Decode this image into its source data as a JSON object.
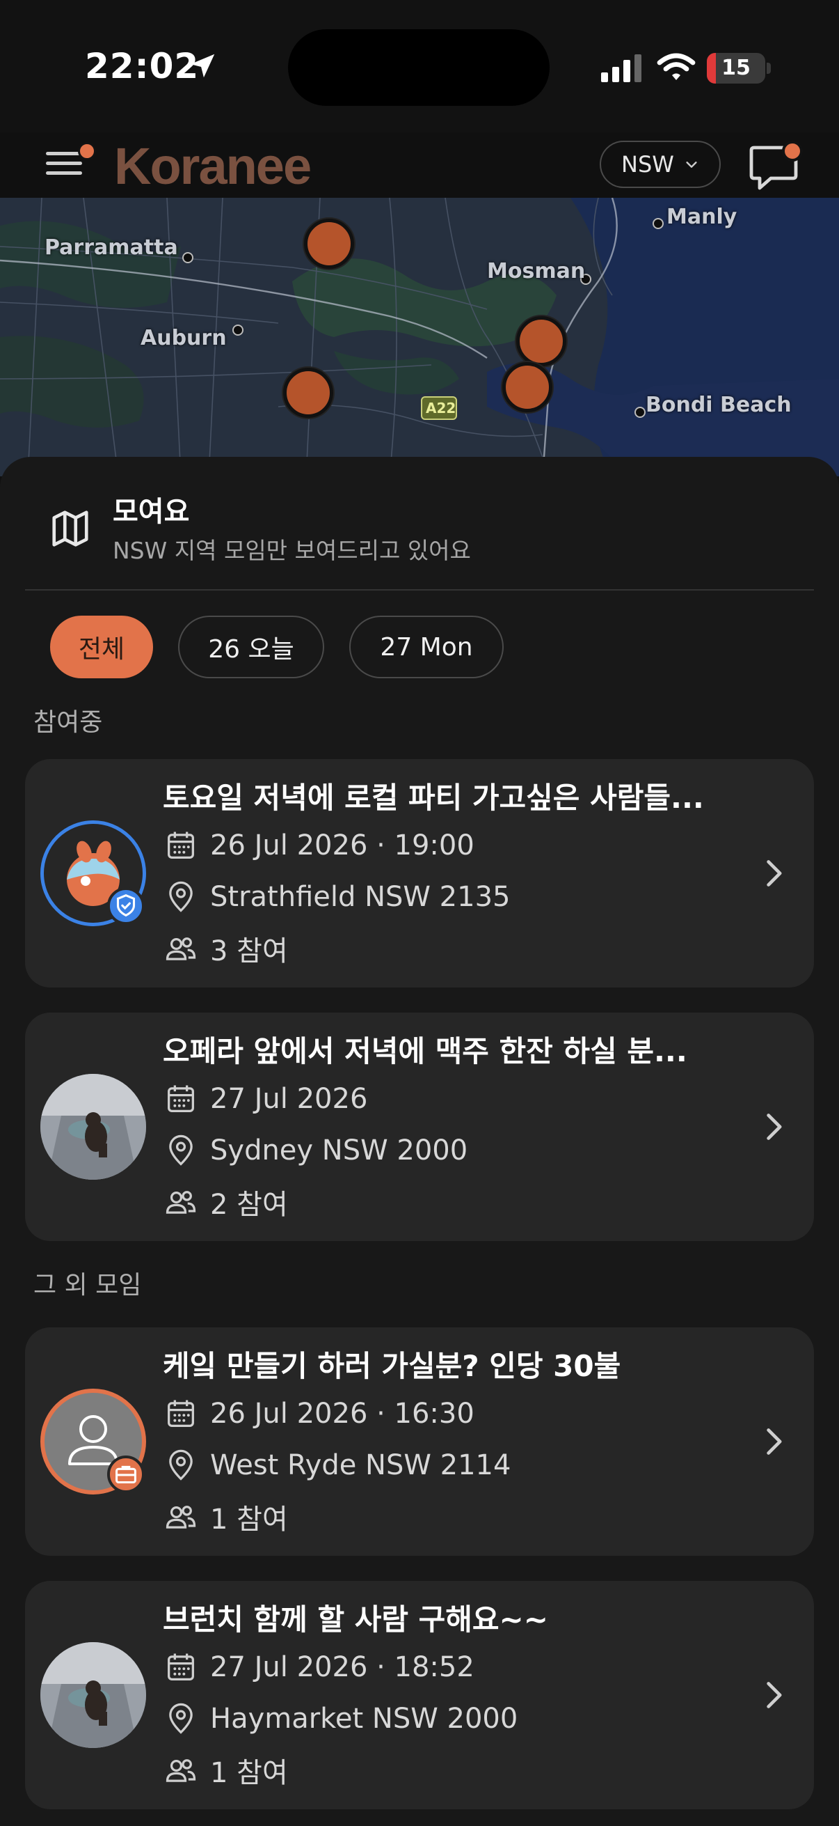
{
  "status_bar": {
    "time": "22:02",
    "battery": "15",
    "battery_level": 0.15
  },
  "header": {
    "logo": "Koranee",
    "region": "NSW"
  },
  "map": {
    "labels": [
      "Parramatta",
      "Mosman",
      "Manly",
      "Auburn",
      "Bondi Beach",
      "A22"
    ]
  },
  "sheet": {
    "title": "모여요",
    "subtitle": "NSW 지역 모임만 보여드리고 있어요"
  },
  "filters": [
    "전체",
    "26 오늘",
    "27 Mon"
  ],
  "sections": {
    "joined": "참여중",
    "others": "그 외 모임"
  },
  "meetups": [
    {
      "title": "토요일 저녁에 로컬 파티 가고싶은 사람들...",
      "datetime": "26 Jul 2026 · 19:00",
      "location": "Strathfield NSW 2135",
      "participants": "3 참여"
    },
    {
      "title": "오페라 앞에서 저녁에 맥주 한잔 하실 분...",
      "datetime": "27 Jul 2026",
      "location": "Sydney NSW 2000",
      "participants": "2 참여"
    },
    {
      "title": "케잌 만들기 하러 가실분? 인당 30불",
      "datetime": "26 Jul 2026 · 16:30",
      "location": "West Ryde NSW 2114",
      "participants": "1 참여"
    },
    {
      "title": "브런치 함께 할 사람 구해요~~",
      "datetime": "27 Jul 2026 · 18:52",
      "location": "Haymarket NSW 2000",
      "participants": "1 참여"
    }
  ],
  "colors": {
    "accent": "#e2734a",
    "pin": "#b5542b",
    "verified": "#3b82e6"
  }
}
